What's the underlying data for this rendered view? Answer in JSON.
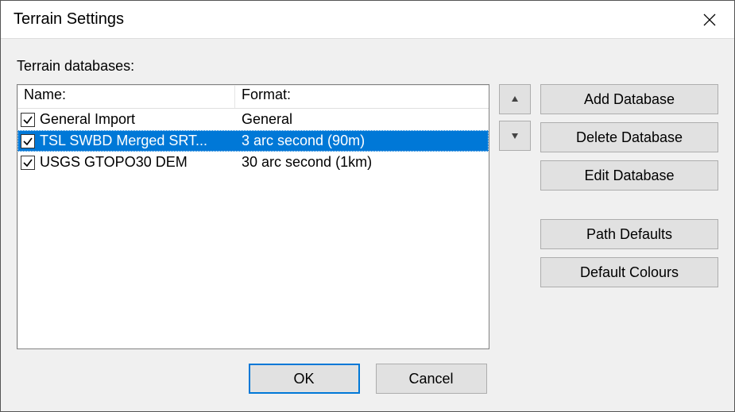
{
  "title": "Terrain Settings",
  "label": "Terrain databases:",
  "columns": {
    "name": "Name:",
    "format": "Format:"
  },
  "rows": [
    {
      "checked": true,
      "selected": false,
      "name": "General Import",
      "format": "General"
    },
    {
      "checked": true,
      "selected": true,
      "name": "TSL SWBD Merged SRT...",
      "format": "3 arc second (90m)"
    },
    {
      "checked": true,
      "selected": false,
      "name": "USGS GTOPO30 DEM",
      "format": "30 arc second (1km)"
    }
  ],
  "side": {
    "add": "Add Database",
    "delete": "Delete Database",
    "edit": "Edit Database",
    "path": "Path Defaults",
    "colours": "Default Colours"
  },
  "bottom": {
    "ok": "OK",
    "cancel": "Cancel"
  }
}
